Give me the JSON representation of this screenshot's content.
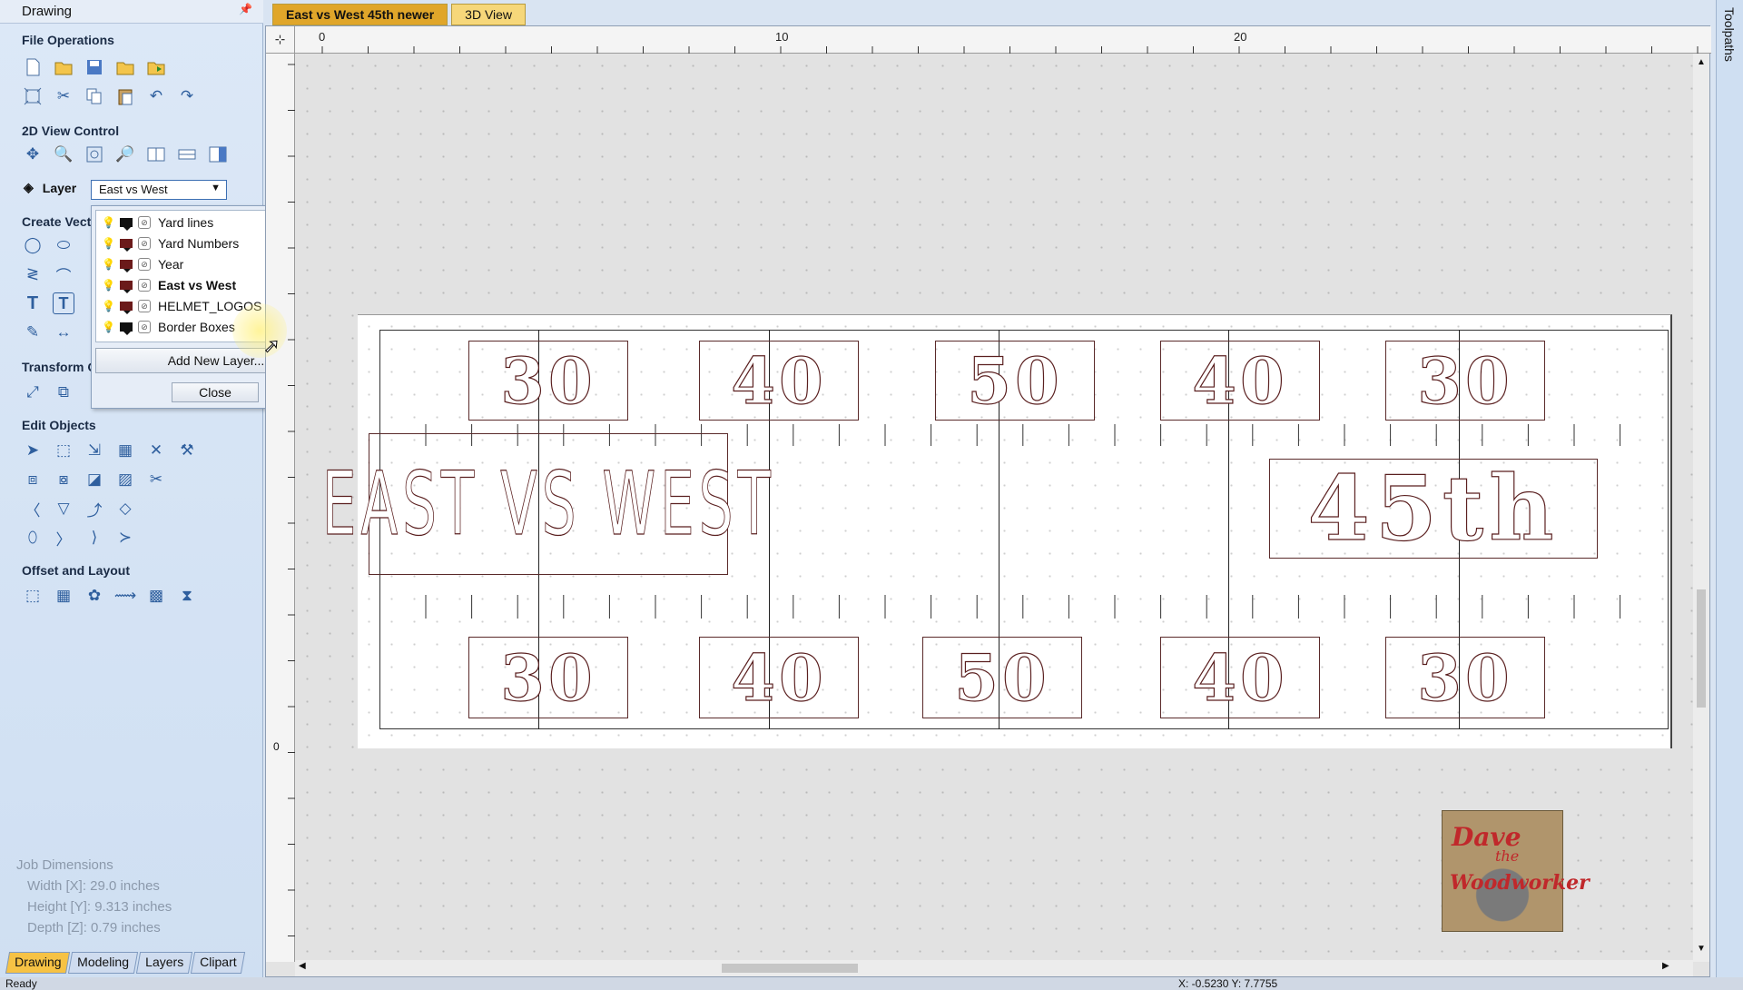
{
  "panel": {
    "title": "Drawing",
    "pin_icon": "pin-icon",
    "sections": {
      "file_ops": "File Operations",
      "view_2d": "2D View Control",
      "create_vectors": "Create Vect",
      "transform": "Transform O",
      "edit_objects": "Edit Objects",
      "offset_layout": "Offset and Layout"
    }
  },
  "layer_control": {
    "label": "Layer",
    "selected": "East vs West",
    "items": [
      {
        "name": "Yard lines",
        "active": false
      },
      {
        "name": "Yard Numbers",
        "active": false
      },
      {
        "name": "Year",
        "active": false
      },
      {
        "name": "East vs West",
        "active": true
      },
      {
        "name": "HELMET_LOGOS",
        "active": false
      },
      {
        "name": "Border Boxes",
        "active": false
      }
    ],
    "add_label": "Add New Layer...",
    "close_label": "Close"
  },
  "job_dimensions": {
    "title": "Job Dimensions",
    "width": "Width  [X]: 29.0 inches",
    "height": "Height [Y]: 9.313 inches",
    "depth": "Depth  [Z]: 0.79 inches"
  },
  "panel_tabs": [
    "Drawing",
    "Modeling",
    "Layers",
    "Clipart"
  ],
  "doc_tabs": [
    "East vs West 45th newer",
    "3D View"
  ],
  "ruler": {
    "labels": [
      "0",
      "10",
      "20"
    ],
    "left_zero": "0"
  },
  "right_panel": "Toolpaths",
  "drawing": {
    "top_numbers": [
      "30",
      "40",
      "50",
      "40",
      "30"
    ],
    "bottom_numbers": [
      "30",
      "40",
      "50",
      "40",
      "30"
    ],
    "title": "EAST VS WEST",
    "year": "45th"
  },
  "logo": {
    "line1": "Dave",
    "line2": "the",
    "line3": "Woodworker"
  },
  "status": {
    "left": "Ready",
    "coords": "X: -0.5230 Y: 7.7755"
  },
  "colors": {
    "accent": "#f6c244",
    "outline": "#5a1f1f",
    "panel": "#cfdff2"
  }
}
